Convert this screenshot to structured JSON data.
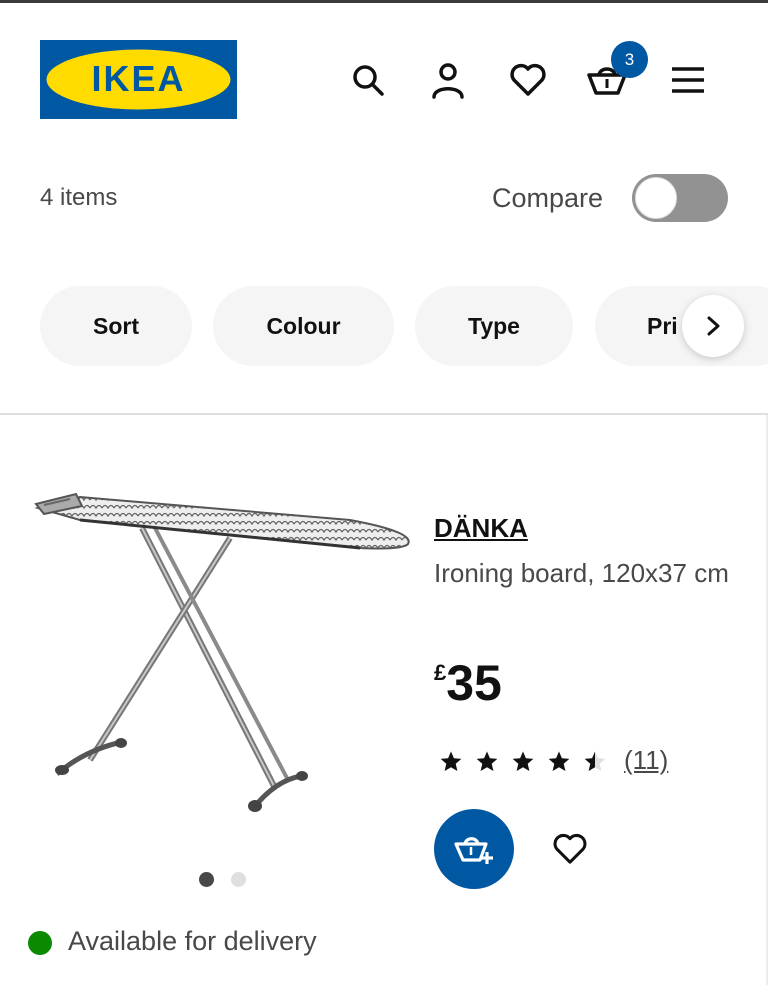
{
  "header": {
    "logo_text": "IKEA",
    "icons": [
      "search-icon",
      "user-icon",
      "heart-icon",
      "basket-icon",
      "menu-icon"
    ],
    "basket_count": "3"
  },
  "list": {
    "items_count": "4 items",
    "compare_label": "Compare",
    "compare_on": false
  },
  "filters": [
    "Sort",
    "Colour",
    "Type",
    "Pri"
  ],
  "product": {
    "name": "DÄNKA",
    "description": "Ironing board, 120x37 cm",
    "currency": "£",
    "price": "35",
    "rating": 4.5,
    "rating_max": 5,
    "reviews": "(11)",
    "image_count": 2,
    "image_index": 1,
    "availability": "Available for delivery"
  },
  "colors": {
    "brand_blue": "#0058a3",
    "brand_yellow": "#ffdb00",
    "available_green": "#0a8a00",
    "toggle_off": "#929292"
  }
}
